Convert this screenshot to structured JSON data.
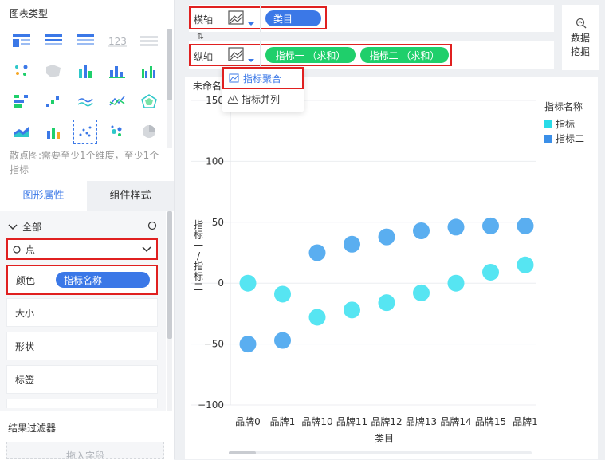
{
  "left_panel": {
    "chart_type_title": "图表类型",
    "chart_hint": "散点图:需要至少1个维度，至少1个指标",
    "tabs": [
      "图形属性",
      "组件样式"
    ],
    "all_label": "全部",
    "mark_type": "点",
    "props": {
      "color_label": "颜色",
      "color_field": "指标名称",
      "size_label": "大小",
      "shape_label": "形状",
      "label_label": "标签"
    },
    "filter_title": "结果过滤器",
    "filter_placeholder": "拖入字段"
  },
  "top": {
    "x_axis_label": "横轴",
    "x_field": "类目",
    "y_axis_label": "纵轴",
    "y_fields": [
      "指标一 （求和）",
      "指标二 （求和）"
    ],
    "data_mining": "数据挖掘",
    "swap_icon": "swap-icon"
  },
  "dropdown": {
    "items": [
      "指标聚合",
      "指标并列"
    ]
  },
  "chart_title": "未命名",
  "colors": {
    "series1": "#56e5f2",
    "series2": "#5aaef0",
    "legend1": "#28dbe8",
    "legend2": "#3b8fe8"
  },
  "chart_data": {
    "type": "scatter",
    "categories": [
      "品牌0",
      "品牌1",
      "品牌10",
      "品牌11",
      "品牌12",
      "品牌13",
      "品牌14",
      "品牌15",
      "品牌1"
    ],
    "series": [
      {
        "name": "指标一",
        "values": [
          0,
          -9,
          -28,
          -22,
          -16,
          -8,
          0,
          9,
          15
        ]
      },
      {
        "name": "指标二",
        "values": [
          -50,
          -47,
          25,
          32,
          38,
          43,
          46,
          47,
          47
        ]
      }
    ],
    "xlabel": "类目",
    "ylabel": "指标一/指标二",
    "ylim": [
      -100,
      150
    ],
    "yticks": [
      "150",
      "100",
      "50",
      "0",
      "−50",
      "−100"
    ],
    "legend_title": "指标名称",
    "grid": true,
    "legend": "top-right"
  }
}
